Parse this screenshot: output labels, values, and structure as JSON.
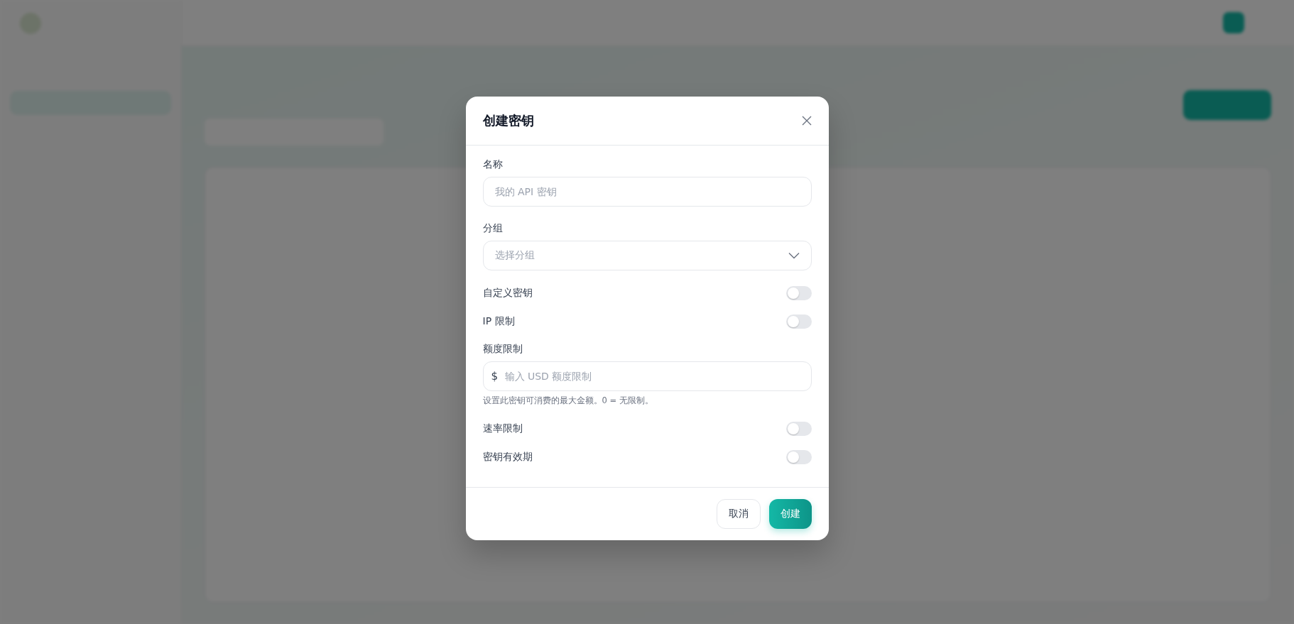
{
  "dialog": {
    "title": "创建密钥",
    "fields": [
      {
        "kind": "text",
        "label": "名称",
        "placeholder": "我的 API 密钥"
      },
      {
        "kind": "select",
        "label": "分组",
        "placeholder": "选择分组"
      },
      {
        "kind": "toggle",
        "label": "自定义密钥",
        "on": false
      },
      {
        "kind": "toggle",
        "label": "IP 限制",
        "on": false
      },
      {
        "kind": "money",
        "label": "额度限制",
        "prefix": "$",
        "placeholder": "输入 USD 额度限制",
        "hint": "设置此密钥可消费的最大金额。0 = 无限制。"
      },
      {
        "kind": "toggle",
        "label": "速率限制",
        "on": false
      },
      {
        "kind": "toggle",
        "label": "密钥有效期",
        "on": false
      }
    ],
    "buttons": [
      {
        "kind": "secondary",
        "label": "取消"
      },
      {
        "kind": "primary",
        "label": "创建"
      }
    ]
  }
}
